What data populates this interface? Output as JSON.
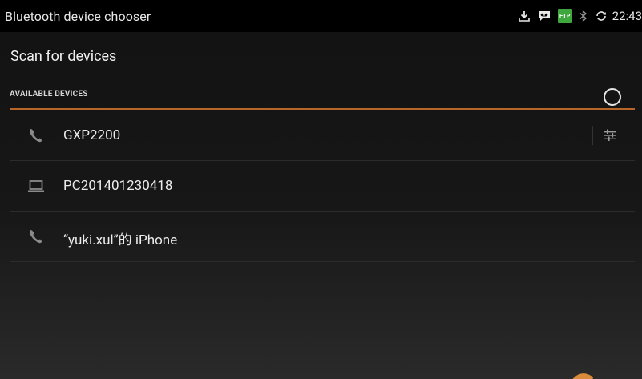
{
  "status_bar": {
    "title": "Bluetooth device chooser",
    "time": "22:43",
    "ftp_badge": "FTP",
    "icons": [
      "download-icon",
      "voicemail-icon",
      "ftp-server-icon",
      "bluetooth-icon",
      "sync-icon"
    ]
  },
  "scan": {
    "label": "Scan for devices"
  },
  "section": {
    "title": "AVAILABLE DEVICES"
  },
  "devices": [
    {
      "name": "GXP2200",
      "icon": "phone-icon"
    },
    {
      "name": "PC201401230418",
      "icon": "laptop-icon"
    },
    {
      "name": "“yuki.xul”的 iPhone",
      "icon": "phone-icon"
    }
  ],
  "colors": {
    "accent": "#b8652a",
    "status_bg": "#000000",
    "text": "#ececec",
    "icon_gray": "#8a8a8a",
    "ftp_green": "#3ea83e"
  }
}
